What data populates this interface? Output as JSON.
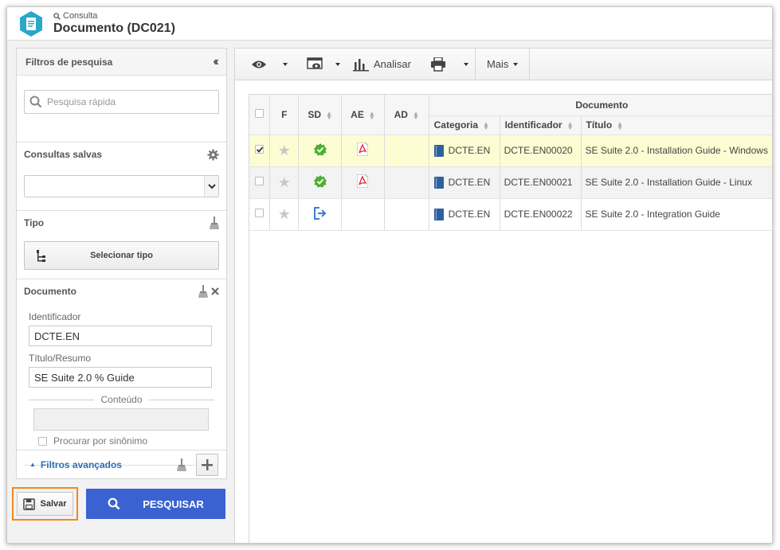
{
  "header": {
    "subtitle": "Consulta",
    "title": "Documento (DC021)"
  },
  "filters": {
    "panel_title": "Filtros de pesquisa",
    "quick_search_placeholder": "Pesquisa rápida",
    "saved_queries_label": "Consultas salvas",
    "saved_queries_value": "",
    "tipo_label": "Tipo",
    "select_tipo_button": "Selecionar tipo",
    "documento_label": "Documento",
    "identificador_label": "Identificador",
    "identificador_value": "DCTE.EN",
    "titulo_label": "Título/Resumo",
    "titulo_value": "SE Suite 2.0 % Guide",
    "conteudo_label": "Conteúdo",
    "sinonimo_label": "Procurar por sinônimo",
    "advanced_label": "Filtros avançados"
  },
  "actions": {
    "save_label": "Salvar",
    "search_label": "PESQUISAR"
  },
  "toolbar": {
    "analisar_label": "Analisar",
    "mais_label": "Mais"
  },
  "grid": {
    "group_header": "Documento",
    "columns": {
      "f": "F",
      "sd": "SD",
      "ae": "AE",
      "ad": "AD",
      "categoria": "Categoria",
      "identificador": "Identificador",
      "titulo": "Título"
    },
    "rows": [
      {
        "selected": true,
        "sd_icon": "approved-badge-icon",
        "ae_icon": "pdf-icon",
        "categoria": "DCTE.EN",
        "identificador": "DCTE.EN00020",
        "titulo": "SE Suite 2.0 - Installation Guide - Windows"
      },
      {
        "selected": false,
        "sd_icon": "approved-badge-icon",
        "ae_icon": "pdf-icon",
        "categoria": "DCTE.EN",
        "identificador": "DCTE.EN00021",
        "titulo": "SE Suite 2.0 - Installation Guide - Linux"
      },
      {
        "selected": false,
        "sd_icon": "export-arrow-icon",
        "ae_icon": "",
        "categoria": "DCTE.EN",
        "identificador": "DCTE.EN00022",
        "titulo": "SE Suite 2.0 - Integration Guide"
      }
    ]
  },
  "colors": {
    "accent_blue": "#3b62d1",
    "highlight_orange": "#f08a1c",
    "selected_row": "#fdfdd3",
    "approved_green": "#4caf2f",
    "pdf_red": "#d9282f",
    "app_icon_teal": "#2aa7c9"
  }
}
